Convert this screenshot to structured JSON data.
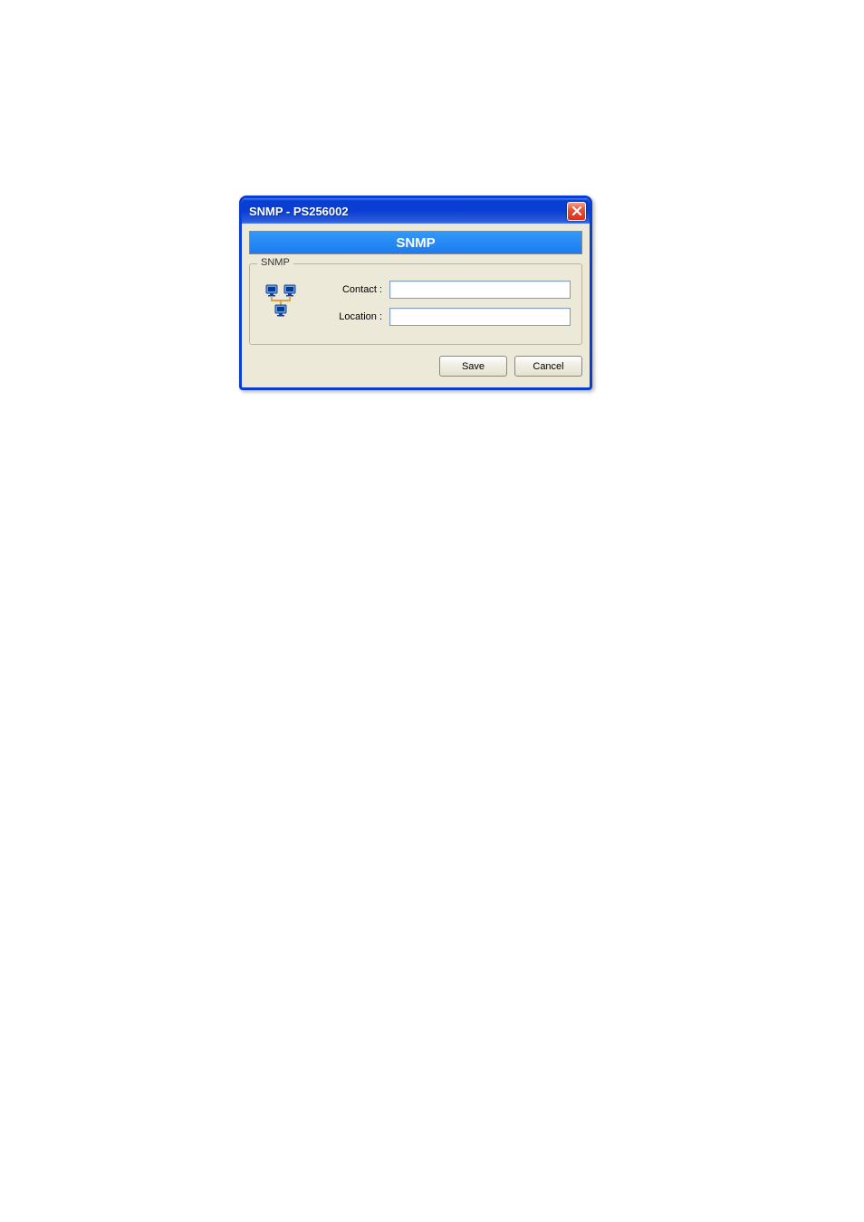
{
  "titlebar": {
    "text": "SNMP - PS256002"
  },
  "header": {
    "banner_text": "SNMP"
  },
  "group": {
    "title": "SNMP",
    "fields": {
      "contact_label": "Contact :",
      "contact_value": "",
      "location_label": "Location :",
      "location_value": ""
    }
  },
  "buttons": {
    "save": "Save",
    "cancel": "Cancel"
  }
}
